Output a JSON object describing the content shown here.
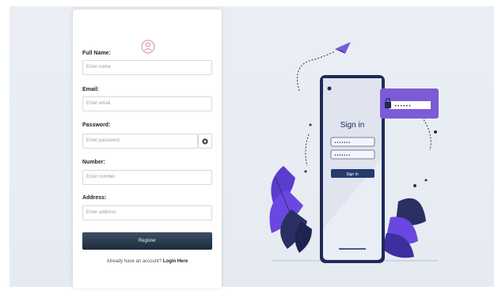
{
  "form": {
    "fields": [
      {
        "label": "Full Name:",
        "placeholder": "Enter name"
      },
      {
        "label": "Email:",
        "placeholder": "Enter email"
      },
      {
        "label": "Password:",
        "placeholder": "Enter password"
      },
      {
        "label": "Number:",
        "placeholder": "Enter number"
      },
      {
        "label": "Address:",
        "placeholder": "Enter address"
      }
    ],
    "register_label": "Register",
    "login_prompt": "Already have an account?",
    "login_link": "Login Here"
  },
  "illustration": {
    "phone_title": "Sign in",
    "phone_button": "Sign In",
    "password_mask": "••••••",
    "field_mask": "•••••••"
  },
  "colors": {
    "accent": "#7b5cd6",
    "dark_button": "#24344a",
    "background": "#e8ecf2"
  },
  "icons": {
    "avatar": "user-circle-icon",
    "eye": "eye-icon",
    "plane": "paper-plane-icon",
    "lock": "lock-icon"
  }
}
